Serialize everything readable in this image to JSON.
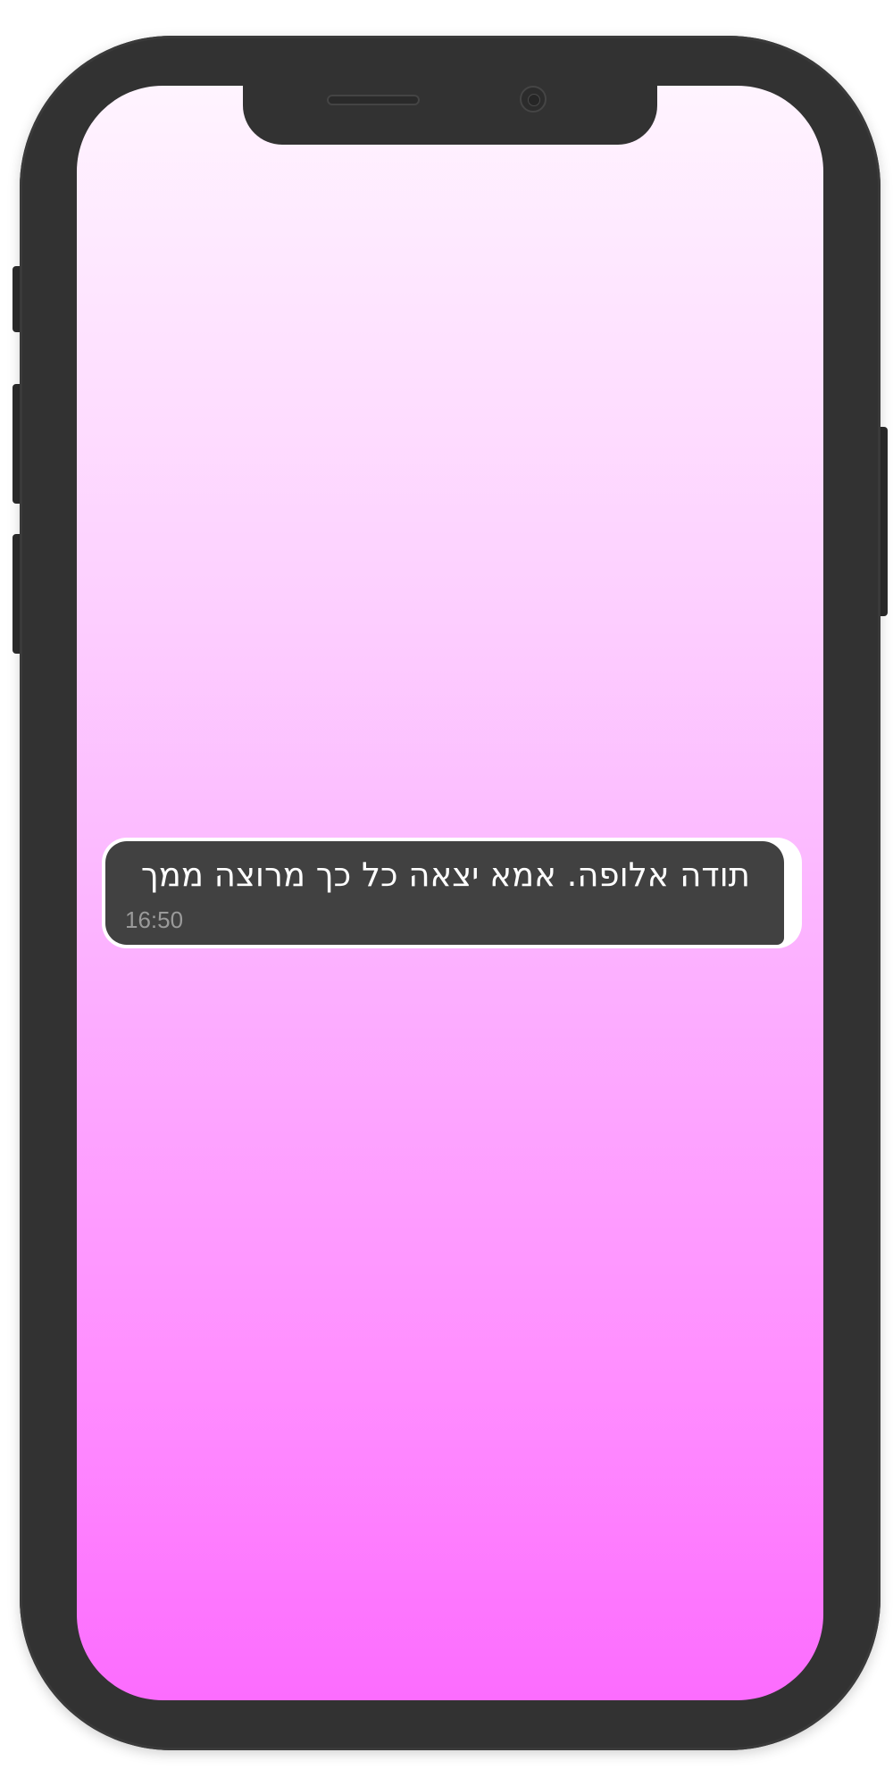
{
  "message": {
    "text": "תודה אלופה. אמא יצאה כל כך מרוצה ממך",
    "time": "16:50"
  },
  "colors": {
    "bubble": "#414141",
    "phone_frame": "#323232",
    "gradient_top": "#fff4ff",
    "gradient_bottom": "#fc6cfe"
  }
}
